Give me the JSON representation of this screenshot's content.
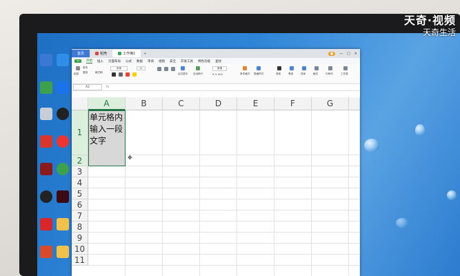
{
  "watermark": {
    "line1": "天奇·视频",
    "line2": "天奇生活"
  },
  "window": {
    "tabs": [
      {
        "label": "首页"
      },
      {
        "label": "稻壳"
      },
      {
        "label": "工作簿1"
      }
    ],
    "new_tab": "+",
    "menu": [
      "开始",
      "插入",
      "页面布局",
      "公式",
      "数据",
      "审阅",
      "视图",
      "安全",
      "开发工具",
      "特色功能",
      "查找"
    ],
    "ribbon": [
      "剪切",
      "粘贴",
      "复制",
      "格式刷",
      "宋体",
      "11",
      "合并居中",
      "自动换行",
      "常规",
      "条件格式",
      "表格样式",
      "求和",
      "筛选",
      "排序",
      "格式",
      "行和列",
      "工作表"
    ],
    "name_box": "A2",
    "fx": "fx"
  },
  "sheet": {
    "columns": [
      "A",
      "B",
      "C",
      "D",
      "E",
      "F",
      "G"
    ],
    "rows": [
      "1",
      "2",
      "3",
      "4",
      "5",
      "6",
      "7",
      "8",
      "9",
      "10",
      "11"
    ],
    "a1_text": "单元格内输入一段文字",
    "cursor": "✥"
  }
}
